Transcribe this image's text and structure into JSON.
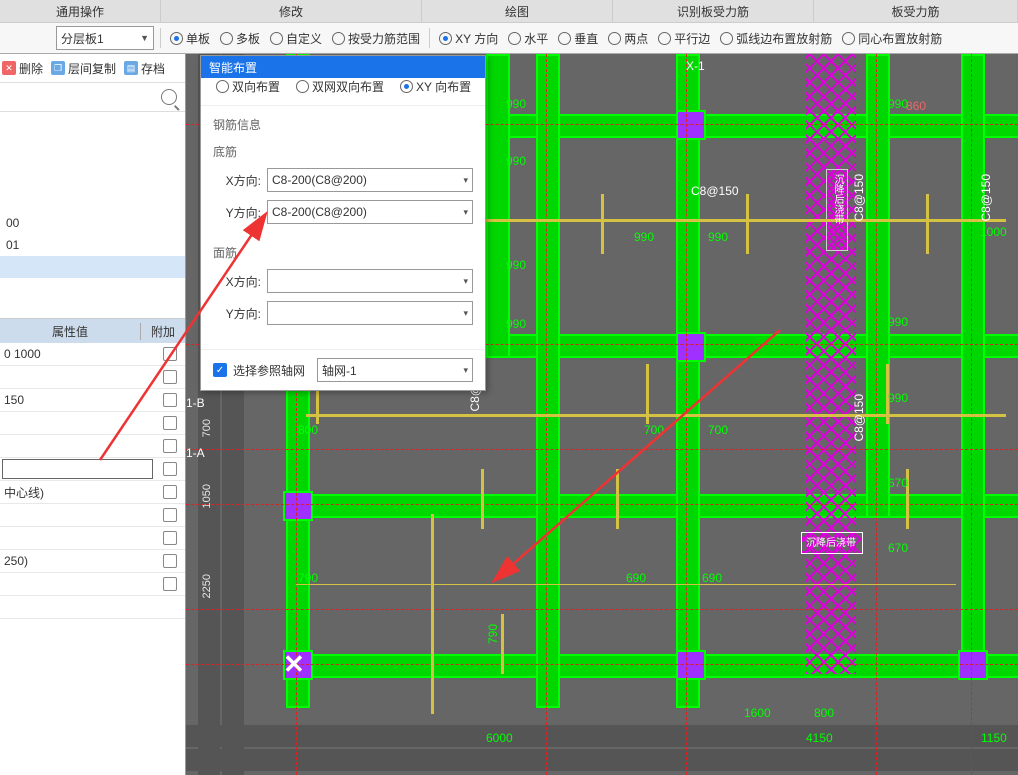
{
  "tabs": {
    "t1": "通用操作",
    "t2": "修改",
    "t3": "绘图",
    "t4": "识别板受力筋",
    "t5": "板受力筋"
  },
  "toolbar": {
    "layer": "分层板1",
    "mode": {
      "single": "单板",
      "multi": "多板",
      "custom": "自定义",
      "byrange": "按受力筋范围"
    },
    "dir": {
      "xy": "XY 方向",
      "h": "水平",
      "v": "垂直",
      "two": "两点",
      "par": "平行边",
      "arc": "弧线边布置放射筋",
      "circ": "同心布置放射筋"
    }
  },
  "sidebar": {
    "tools": {
      "del": "删除",
      "copy": "层间复制",
      "arch": "存档"
    },
    "items": {
      "l1": "00",
      "l2": "01"
    },
    "prop_head": {
      "val": "属性值",
      "add": "附加"
    },
    "rows": {
      "r1": "0 1000",
      "r2": "150",
      "r3": "中心线)",
      "r4": "250)"
    }
  },
  "panel": {
    "title": "智能布置",
    "opt": {
      "a": "双向布置",
      "b": "双网双向布置",
      "c": "XY 向布置"
    },
    "group": "钢筋信息",
    "bottom": "底筋",
    "top": "面筋",
    "xdir": "X方向:",
    "ydir": "Y方向:",
    "val": "C8-200(C8@200)",
    "checkref": "选择参照轴网",
    "gridname": "轴网-1"
  },
  "drawing": {
    "axis1": "1-B",
    "axis2": "1-A",
    "dims": {
      "d700": "700",
      "d1050": "1050",
      "d2250": "2250",
      "d6000": "6000",
      "d4150": "4150",
      "d1150": "1150",
      "d1600": "1600",
      "d800": "800",
      "d860": "860",
      "d990": "990",
      "d1000": "1000",
      "d800b": "800",
      "d790": "790",
      "d690": "690",
      "d670": "670"
    },
    "lbl": {
      "c8150": "C8@150",
      "tag": "沉降后浇带"
    }
  }
}
